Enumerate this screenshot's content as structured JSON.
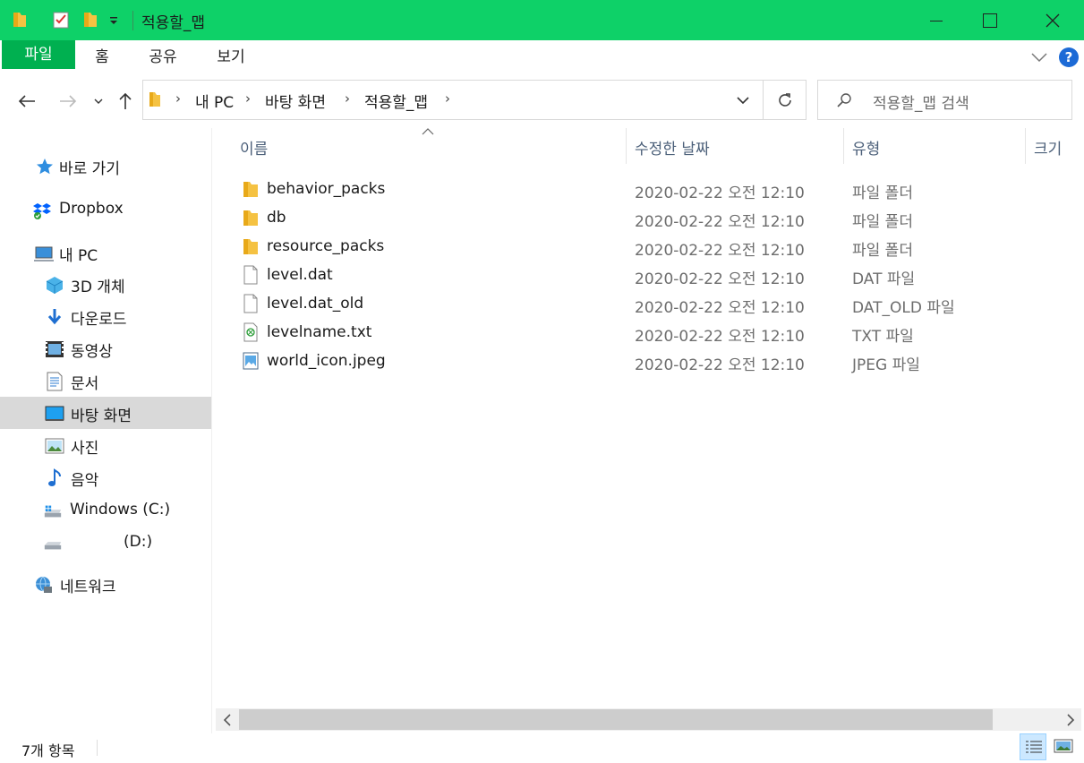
{
  "window": {
    "title": "적용할_맵"
  },
  "ribbon": {
    "tabs": [
      "파일",
      "홈",
      "공유",
      "보기"
    ],
    "help_label": "?"
  },
  "address": {
    "crumbs": [
      "내 PC",
      "바탕 화면",
      "적용할_맵"
    ],
    "search_placeholder": "적용할_맵 검색"
  },
  "sidebar": {
    "items": [
      {
        "label": "바로 가기",
        "icon": "star-icon"
      },
      {
        "label": "Dropbox",
        "icon": "dropbox-icon"
      },
      {
        "label": "내 PC",
        "icon": "computer-icon"
      },
      {
        "label": "3D 개체",
        "icon": "cube-icon"
      },
      {
        "label": "다운로드",
        "icon": "download-icon"
      },
      {
        "label": "동영상",
        "icon": "video-icon"
      },
      {
        "label": "문서",
        "icon": "document-icon"
      },
      {
        "label": "바탕 화면",
        "icon": "desktop-icon"
      },
      {
        "label": "사진",
        "icon": "picture-icon"
      },
      {
        "label": "음악",
        "icon": "music-icon"
      },
      {
        "label": "Windows (C:)",
        "icon": "drive-c-icon"
      },
      {
        "label": "(D:)",
        "icon": "drive-d-icon"
      },
      {
        "label": "네트워크",
        "icon": "network-icon"
      }
    ],
    "selected": "바탕 화면"
  },
  "columns": {
    "name": "이름",
    "date": "수정한 날짜",
    "type": "유형",
    "size": "크기"
  },
  "files": [
    {
      "name": "behavior_packs",
      "date": "2020-02-22 오전 12:10",
      "type": "파일 폴더",
      "icon": "folder-icon"
    },
    {
      "name": "db",
      "date": "2020-02-22 오전 12:10",
      "type": "파일 폴더",
      "icon": "folder-icon"
    },
    {
      "name": "resource_packs",
      "date": "2020-02-22 오전 12:10",
      "type": "파일 폴더",
      "icon": "folder-icon"
    },
    {
      "name": "level.dat",
      "date": "2020-02-22 오전 12:10",
      "type": "DAT 파일",
      "icon": "file-icon"
    },
    {
      "name": "level.dat_old",
      "date": "2020-02-22 오전 12:10",
      "type": "DAT_OLD 파일",
      "icon": "file-icon"
    },
    {
      "name": "levelname.txt",
      "date": "2020-02-22 오전 12:10",
      "type": "TXT 파일",
      "icon": "text-file-icon"
    },
    {
      "name": "world_icon.jpeg",
      "date": "2020-02-22 오전 12:10",
      "type": "JPEG 파일",
      "icon": "image-file-icon"
    }
  ],
  "status": {
    "item_count": "7개 항목"
  },
  "colors": {
    "titlebar": "#0ed168",
    "file_tab": "#00b050",
    "selected_nav": "#d9d9d9"
  }
}
